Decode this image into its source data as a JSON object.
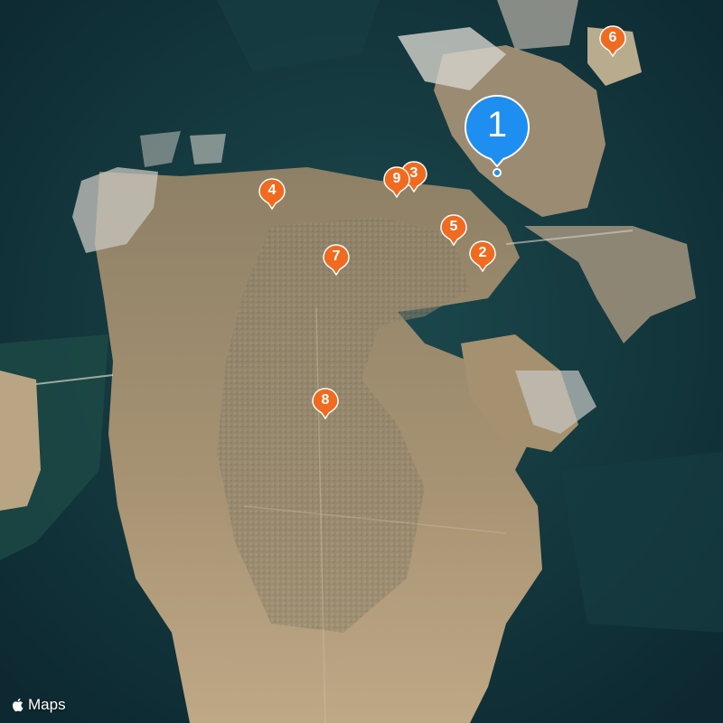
{
  "map": {
    "type": "satellite",
    "attribution": "Maps",
    "colors": {
      "sea": "#143a40",
      "land": "#a89474",
      "marker_orange": "#f06a1f",
      "marker_blue": "#1e8ff0"
    }
  },
  "markers": [
    {
      "label": "1",
      "color": "blue",
      "selected": true
    },
    {
      "label": "2",
      "color": "orange"
    },
    {
      "label": "3",
      "color": "orange"
    },
    {
      "label": "4",
      "color": "orange"
    },
    {
      "label": "5",
      "color": "orange"
    },
    {
      "label": "6",
      "color": "orange"
    },
    {
      "label": "7",
      "color": "orange"
    },
    {
      "label": "8",
      "color": "orange"
    },
    {
      "label": "9",
      "color": "orange"
    }
  ]
}
